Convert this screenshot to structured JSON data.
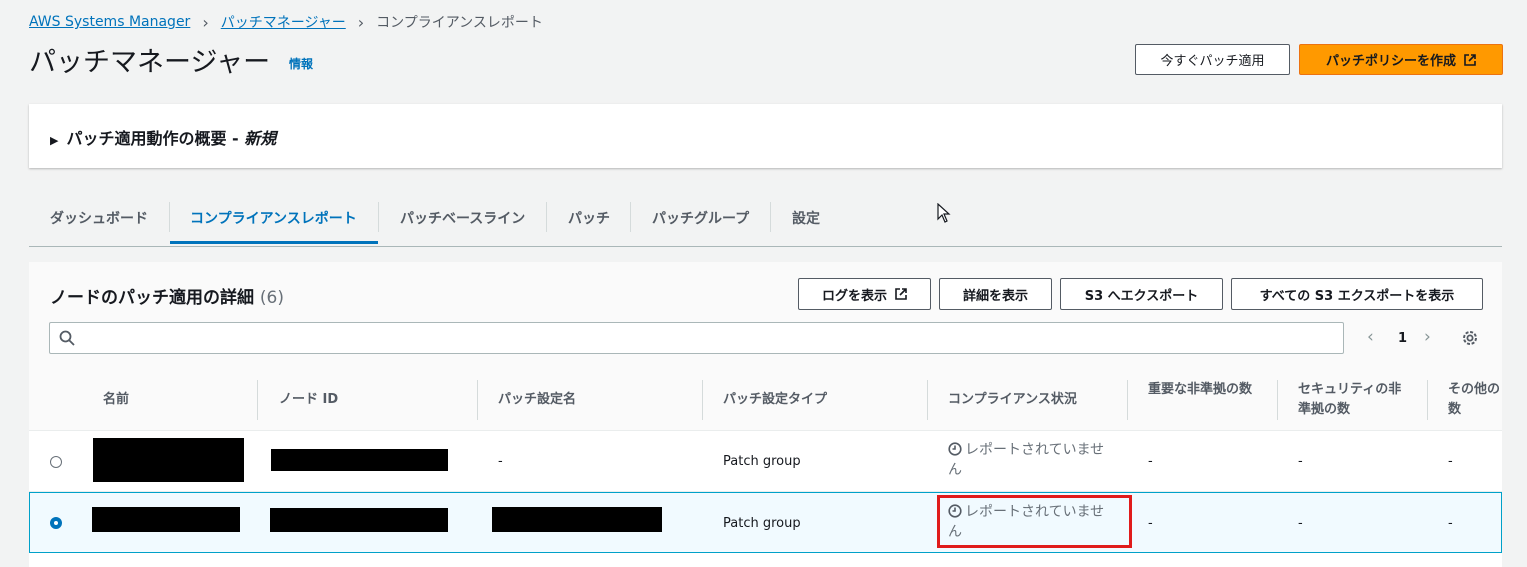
{
  "breadcrumb": {
    "items": [
      "AWS Systems Manager",
      "パッチマネージャー"
    ],
    "current": "コンプライアンスレポート"
  },
  "header": {
    "title": "パッチマネージャー",
    "info_link": "情報",
    "apply_now_label": "今すぐパッチ適用",
    "create_policy_label": "パッチポリシーを作成"
  },
  "overview": {
    "label": "パッチ適用動作の概要 - ",
    "label_new": "新規"
  },
  "tabs": [
    "ダッシュボード",
    "コンプライアンスレポート",
    "パッチベースライン",
    "パッチ",
    "パッチグループ",
    "設定"
  ],
  "table": {
    "title": "ノードのパッチ適用の詳細",
    "count": "(6)",
    "buttons": {
      "view_logs": "ログを表示",
      "view_details": "詳細を表示",
      "export_s3": "S3 へエクスポート",
      "view_all_exports": "すべての S3 エクスポートを表示"
    },
    "search_placeholder": "",
    "page": "1",
    "columns": [
      "名前",
      "ノード ID",
      "パッチ設定名",
      "パッチ設定タイプ",
      "コンプライアンス状況",
      "重要な非準拠の数",
      "セキュリティの非準拠の数",
      "その他の数"
    ],
    "rows": [
      {
        "patch_config_name": "-",
        "patch_config_type": "Patch group",
        "status": "レポートされていません",
        "critical": "-",
        "security": "-",
        "other": "-",
        "selected": false
      },
      {
        "patch_config_name": "",
        "patch_config_type": "Patch group",
        "status": "レポートされていません",
        "critical": "-",
        "security": "-",
        "other": "-",
        "selected": true
      }
    ]
  },
  "colors": {
    "accent": "#0073bb",
    "primary_button": "#ff9900",
    "highlight": "#e01b1b"
  }
}
